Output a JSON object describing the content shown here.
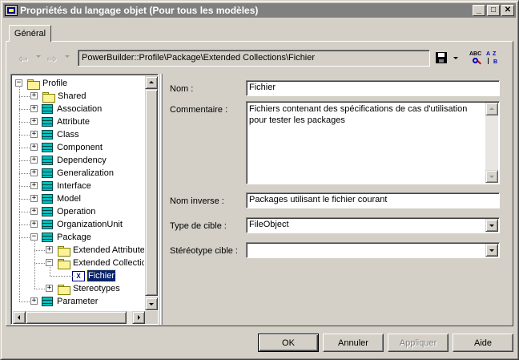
{
  "window": {
    "title": "Propriétés du langage objet (Pour tous les modèles)",
    "minimize": "_",
    "maximize": "□",
    "close": "✕"
  },
  "tabs": [
    {
      "label": "Général",
      "active": true
    }
  ],
  "toolbar": {
    "back_icon": "back-arrow-icon",
    "forward_icon": "forward-arrow-icon",
    "path": "PowerBuilder::Profile\\Package\\Extended Collections\\Fichier",
    "spell_icon_text": "ABC",
    "sort_icon_text_a": "A",
    "sort_icon_text_z": "Z",
    "sort_icon_text_b": "B"
  },
  "tree": {
    "items": [
      {
        "label": "Profile",
        "icon": "folder",
        "level": 0,
        "expander": "−"
      },
      {
        "label": "Shared",
        "icon": "folder",
        "level": 1,
        "expander": "+"
      },
      {
        "label": "Association",
        "icon": "metaclass",
        "level": 1,
        "expander": "+"
      },
      {
        "label": "Attribute",
        "icon": "metaclass",
        "level": 1,
        "expander": "+"
      },
      {
        "label": "Class",
        "icon": "metaclass",
        "level": 1,
        "expander": "+"
      },
      {
        "label": "Component",
        "icon": "metaclass",
        "level": 1,
        "expander": "+"
      },
      {
        "label": "Dependency",
        "icon": "metaclass",
        "level": 1,
        "expander": "+"
      },
      {
        "label": "Generalization",
        "icon": "metaclass",
        "level": 1,
        "expander": "+"
      },
      {
        "label": "Interface",
        "icon": "metaclass",
        "level": 1,
        "expander": "+"
      },
      {
        "label": "Model",
        "icon": "metaclass",
        "level": 1,
        "expander": "+"
      },
      {
        "label": "Operation",
        "icon": "metaclass",
        "level": 1,
        "expander": "+"
      },
      {
        "label": "OrganizationUnit",
        "icon": "metaclass",
        "level": 1,
        "expander": "+"
      },
      {
        "label": "Package",
        "icon": "metaclass",
        "level": 1,
        "expander": "−"
      },
      {
        "label": "Extended Attributes",
        "icon": "folder",
        "level": 2,
        "expander": "+"
      },
      {
        "label": "Extended Collections",
        "icon": "folder",
        "level": 2,
        "expander": "−"
      },
      {
        "label": "Fichier",
        "icon": "file",
        "level": 3,
        "expander": "",
        "selected": true
      },
      {
        "label": "Stereotypes",
        "icon": "folder",
        "level": 2,
        "expander": "+"
      },
      {
        "label": "Parameter",
        "icon": "metaclass",
        "level": 1,
        "expander": "+"
      }
    ],
    "file_icon_text": "X"
  },
  "form": {
    "nom_label": "Nom :",
    "nom_value": "Fichier",
    "commentaire_label": "Commentaire :",
    "commentaire_value": "Fichiers contenant des spécifications de cas d'utilisation pour tester les packages",
    "nom_inverse_label": "Nom inverse :",
    "nom_inverse_value": "Packages utilisant le fichier courant",
    "type_cible_label": "Type de cible :",
    "type_cible_value": "FileObject",
    "stereotype_cible_label": "Stéréotype cible :",
    "stereotype_cible_value": ""
  },
  "buttons": {
    "ok": "OK",
    "annuler": "Annuler",
    "appliquer": "Appliquer",
    "aide": "Aide"
  }
}
